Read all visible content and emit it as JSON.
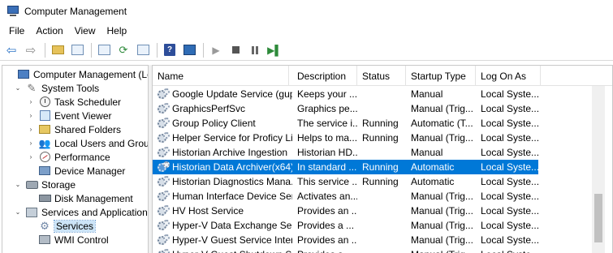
{
  "window": {
    "title": "Computer Management"
  },
  "menu": [
    "File",
    "Action",
    "View",
    "Help"
  ],
  "tree": [
    {
      "label": "Computer Management (Local",
      "icon": "computer-icon",
      "twist": "",
      "indent": 0
    },
    {
      "label": "System Tools",
      "icon": "tools-icon",
      "twist": "⌄",
      "indent": 1
    },
    {
      "label": "Task Scheduler",
      "icon": "clock-icon",
      "twist": "›",
      "indent": 2
    },
    {
      "label": "Event Viewer",
      "icon": "event-viewer-icon",
      "twist": "›",
      "indent": 2
    },
    {
      "label": "Shared Folders",
      "icon": "shared-folder-icon",
      "twist": "›",
      "indent": 2
    },
    {
      "label": "Local Users and Groups",
      "icon": "users-icon",
      "twist": "›",
      "indent": 2
    },
    {
      "label": "Performance",
      "icon": "performance-icon",
      "twist": "›",
      "indent": 2
    },
    {
      "label": "Device Manager",
      "icon": "device-manager-icon",
      "twist": "",
      "indent": 2
    },
    {
      "label": "Storage",
      "icon": "storage-icon",
      "twist": "⌄",
      "indent": 1
    },
    {
      "label": "Disk Management",
      "icon": "disk-icon",
      "twist": "",
      "indent": 2
    },
    {
      "label": "Services and Applications",
      "icon": "services-apps-icon",
      "twist": "⌄",
      "indent": 1
    },
    {
      "label": "Services",
      "icon": "gear-icon",
      "twist": "",
      "indent": 2,
      "selected": true
    },
    {
      "label": "WMI Control",
      "icon": "wmi-icon",
      "twist": "",
      "indent": 2
    }
  ],
  "columns": {
    "name": "Name",
    "description": "Description",
    "status": "Status",
    "startup": "Startup Type",
    "logon": "Log On As"
  },
  "services": [
    {
      "name": "Google Update Service (gup...",
      "description": "Keeps your ...",
      "status": "",
      "startup": "Manual",
      "logon": "Local Syste..."
    },
    {
      "name": "GraphicsPerfSvc",
      "description": "Graphics pe...",
      "status": "",
      "startup": "Manual (Trig...",
      "logon": "Local Syste..."
    },
    {
      "name": "Group Policy Client",
      "description": "The service i...",
      "status": "Running",
      "startup": "Automatic (T...",
      "logon": "Local Syste..."
    },
    {
      "name": "Helper Service for Proficy Li...",
      "description": "Helps to ma...",
      "status": "Running",
      "startup": "Manual (Trig...",
      "logon": "Local Syste..."
    },
    {
      "name": "Historian Archive Ingestion",
      "description": "Historian HD...",
      "status": "",
      "startup": "Manual",
      "logon": "Local Syste..."
    },
    {
      "name": "Historian Data Archiver(x64)",
      "description": "In standard ...",
      "status": "Running",
      "startup": "Automatic",
      "logon": "Local Syste...",
      "selected": true
    },
    {
      "name": "Historian Diagnostics Mana...",
      "description": "This service ...",
      "status": "Running",
      "startup": "Automatic",
      "logon": "Local Syste..."
    },
    {
      "name": "Human Interface Device Ser...",
      "description": "Activates an...",
      "status": "",
      "startup": "Manual (Trig...",
      "logon": "Local Syste..."
    },
    {
      "name": "HV Host Service",
      "description": "Provides an ...",
      "status": "",
      "startup": "Manual (Trig...",
      "logon": "Local Syste..."
    },
    {
      "name": "Hyper-V Data Exchange Ser...",
      "description": "Provides a ...",
      "status": "",
      "startup": "Manual (Trig...",
      "logon": "Local Syste..."
    },
    {
      "name": "Hyper-V Guest Service Inter...",
      "description": "Provides an ...",
      "status": "",
      "startup": "Manual (Trig...",
      "logon": "Local Syste..."
    },
    {
      "name": "Hyper-V Guest Shutdown S...",
      "description": "Provides a ...",
      "status": "",
      "startup": "Manual (Trig...",
      "logon": "Local Syste..."
    }
  ],
  "colors": {
    "selection": "#0078d7",
    "tree_selection": "#cce4f7"
  }
}
